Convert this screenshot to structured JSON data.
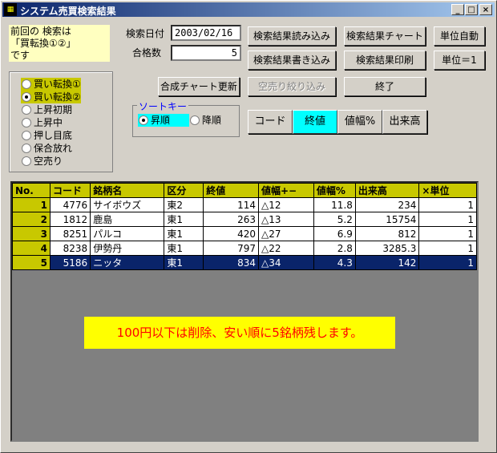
{
  "window": {
    "title": "システム売買検索結果",
    "app_icon_text": ""
  },
  "note": {
    "line1": "前回の 検索は",
    "line2": "「買転換①②」",
    "line3": "です"
  },
  "search": {
    "date_label": "検索日付",
    "date_value": "2003/02/16",
    "count_label": "合格数",
    "count_value": "5"
  },
  "buttons": {
    "load": "検索結果読み込み",
    "chart": "検索結果チャート",
    "unit_auto": "単位自動",
    "save": "検索結果書き込み",
    "print": "検索結果印刷",
    "unit_one": "単位＝1",
    "composite": "合成チャート更新",
    "short_filter": "空売り絞り込み",
    "exit": "終了"
  },
  "radio_options": [
    "買い転換①",
    "買い転換②",
    "上昇初期",
    "上昇中",
    "押し目底",
    "保合放れ",
    "空売り"
  ],
  "radio_selected": 1,
  "sort": {
    "label": "ソートキー",
    "asc": "昇順",
    "desc": "降順",
    "keys": [
      "コード",
      "終値",
      "値幅%",
      "出来高"
    ],
    "active_key": 1
  },
  "table": {
    "headers": [
      "No.",
      "コード",
      "銘柄名",
      "区分",
      "終値",
      "値幅+−",
      "値幅%",
      "出来高",
      "×単位"
    ],
    "rows": [
      [
        "1",
        "4776",
        "サイボウズ",
        "東2",
        "114",
        "△12",
        "11.8",
        "234",
        "1"
      ],
      [
        "2",
        "1812",
        "鹿島",
        "東1",
        "263",
        "△13",
        "5.2",
        "15754",
        "1"
      ],
      [
        "3",
        "8251",
        "パルコ",
        "東1",
        "420",
        "△27",
        "6.9",
        "812",
        "1"
      ],
      [
        "4",
        "8238",
        "伊勢丹",
        "東1",
        "797",
        "△22",
        "2.8",
        "3285.3",
        "1"
      ],
      [
        "5",
        "5186",
        "ニッタ",
        "東1",
        "834",
        "△34",
        "4.3",
        "142",
        "1"
      ]
    ],
    "selected_row": 4
  },
  "banner": "100円以下は削除、安い順に5銘柄残します。",
  "colors": {
    "highlight": "#c8c800",
    "active": "#00ffff",
    "note_bg": "#ffffc0",
    "banner_bg": "#ffff00",
    "banner_text": "#ff0000"
  }
}
